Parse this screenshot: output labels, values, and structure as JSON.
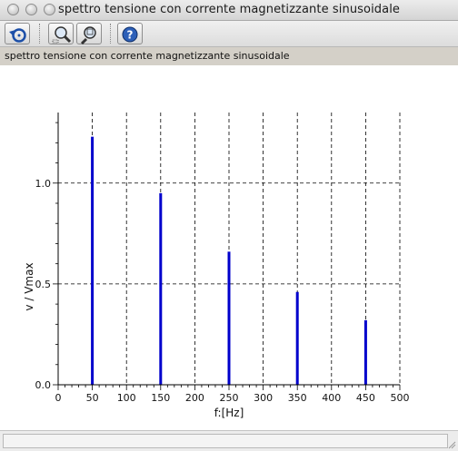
{
  "window": {
    "title": "spettro tensione con corrente magnetizzante sinusoidale"
  },
  "toolbar": {
    "buttons": [
      {
        "name": "rotate-button",
        "icon": "rotate-icon"
      },
      {
        "name": "zoom-button",
        "icon": "zoom-icon"
      },
      {
        "name": "unzoom-button",
        "icon": "unzoom-icon"
      },
      {
        "name": "help-button",
        "icon": "help-icon"
      }
    ]
  },
  "section": {
    "title": "spettro tensione con corrente magnetizzante sinusoidale"
  },
  "chart_data": {
    "type": "bar",
    "xlabel": "f:[Hz]",
    "ylabel": "v / Vmax",
    "xlim": [
      0,
      500
    ],
    "ylim": [
      0,
      1.35
    ],
    "xticks": [
      "0",
      "50",
      "100",
      "150",
      "200",
      "250",
      "300",
      "350",
      "400",
      "450",
      "500"
    ],
    "yticks": [
      "0.0",
      "0.5",
      "1.0"
    ],
    "x": [
      50,
      150,
      250,
      350,
      450
    ],
    "values": [
      1.23,
      0.95,
      0.66,
      0.46,
      0.32
    ],
    "bar_color": "#0000cc",
    "grid": "dashed",
    "legend": "none"
  }
}
